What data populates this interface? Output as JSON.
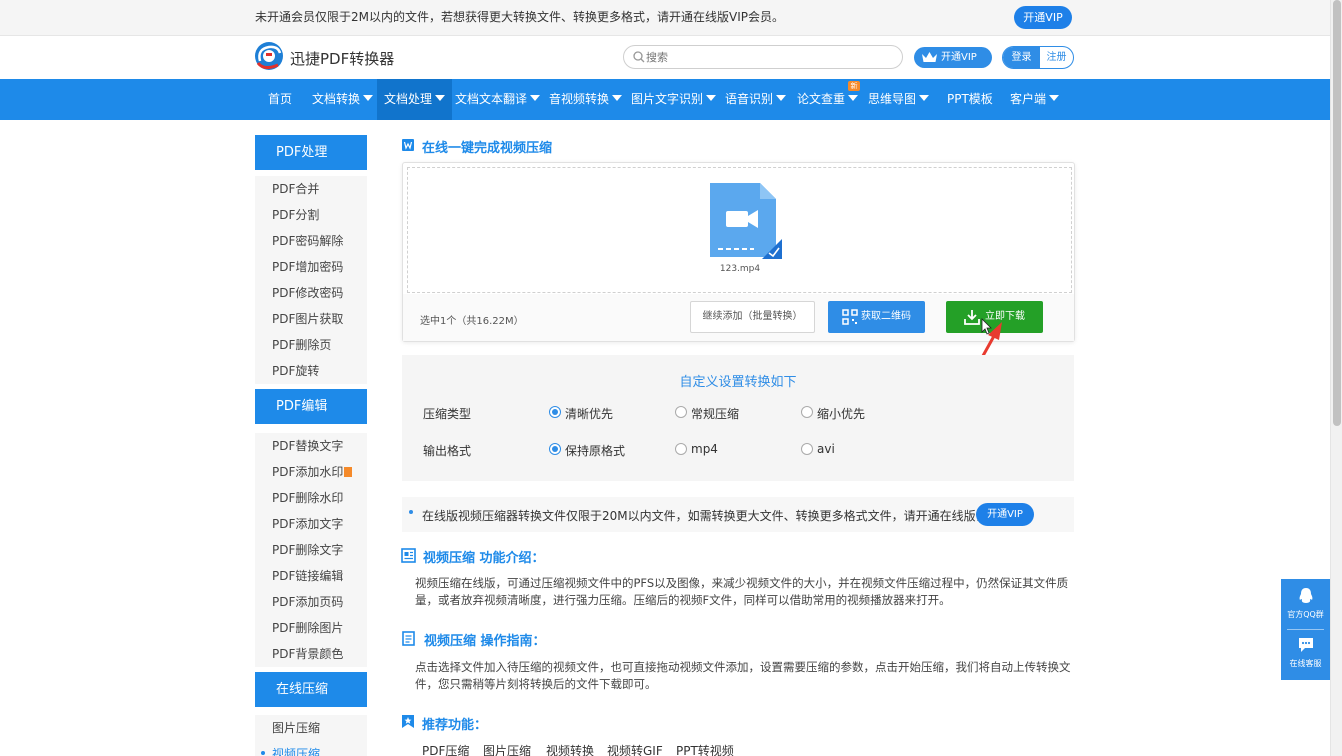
{
  "notice": {
    "text": "未开通会员仅限于2M以内的文件，若想获得更大转换文件、转换更多格式，请开通在线版VIP会员。",
    "vip_button": "开通VIP"
  },
  "header": {
    "logo_text": "迅捷PDF转换器",
    "search_placeholder": "搜索",
    "vip_button": "开通VIP",
    "login": "登录",
    "register": "注册"
  },
  "nav": {
    "items": [
      {
        "label": "首页"
      },
      {
        "label": "文档转换"
      },
      {
        "label": "文档处理"
      },
      {
        "label": "文档文本翻译"
      },
      {
        "label": "音视频转换"
      },
      {
        "label": "图片文字识别"
      },
      {
        "label": "语音识别"
      },
      {
        "label": "论文查重"
      },
      {
        "label": "思维导图"
      },
      {
        "label": "PPT模板"
      },
      {
        "label": "客户端"
      }
    ],
    "new_badge": "新"
  },
  "sidebar": {
    "sections": [
      {
        "title": "PDF处理",
        "items": [
          "PDF合并",
          "PDF分割",
          "PDF密码解除",
          "PDF增加密码",
          "PDF修改密码",
          "PDF图片获取",
          "PDF删除页",
          "PDF旋转"
        ]
      },
      {
        "title": "PDF编辑",
        "items": [
          "PDF替换文字",
          "PDF添加水印",
          "PDF删除水印",
          "PDF添加文字",
          "PDF删除文字",
          "PDF链接编辑",
          "PDF添加页码",
          "PDF删除图片",
          "PDF背景颜色"
        ]
      },
      {
        "title": "在线压缩",
        "items": [
          "图片压缩",
          "视频压缩"
        ]
      }
    ]
  },
  "main": {
    "title": "在线一键完成视频压缩",
    "file_name": "123.mp4",
    "selected_info": "选中1个（共16.22M）",
    "add_button": "继续添加（批量转换）",
    "qr_button": "获取二维码",
    "download_button": "立即下载"
  },
  "settings": {
    "title": "自定义设置转换如下",
    "compress_label": "压缩类型",
    "compress_options": [
      "清晰优先",
      "常规压缩",
      "缩小优先"
    ],
    "format_label": "输出格式",
    "format_options": [
      "保持原格式",
      "mp4",
      "avi"
    ]
  },
  "vip_tip": {
    "text": "在线版视频压缩器转换文件仅限于20M以内文件，如需转换更大文件、转换更多格式文件，请开通在线版会员。",
    "button": "开通VIP"
  },
  "intro": {
    "title": "视频压缩 功能介绍：",
    "text": "视频压缩在线版，可通过压缩视频文件中的PFS以及图像，来减少视频文件的大小，并在视频文件压缩过程中，仍然保证其文件质量，或者放弃视频清晰度，进行强力压缩。压缩后的视频F文件，同样可以借助常用的视频播放器来打开。"
  },
  "guide": {
    "title": "视频压缩 操作指南：",
    "text": "点击选择文件加入待压缩的视频文件，也可直接拖动视频文件添加，设置需要压缩的参数，点击开始压缩，我们将自动上传转换文件，您只需稍等片刻将转换后的文件下载即可。"
  },
  "recommend": {
    "title": "推荐功能：",
    "links": [
      "PDF压缩",
      "图片压缩",
      "视频转换",
      "视频转GIF",
      "PPT转视频"
    ]
  },
  "float": {
    "qq": "官方QQ群",
    "service": "在线客服"
  },
  "colors": {
    "brand_blue": "#1e8ae9",
    "download_green": "#24a027",
    "arrow_red": "#e83a2f"
  }
}
